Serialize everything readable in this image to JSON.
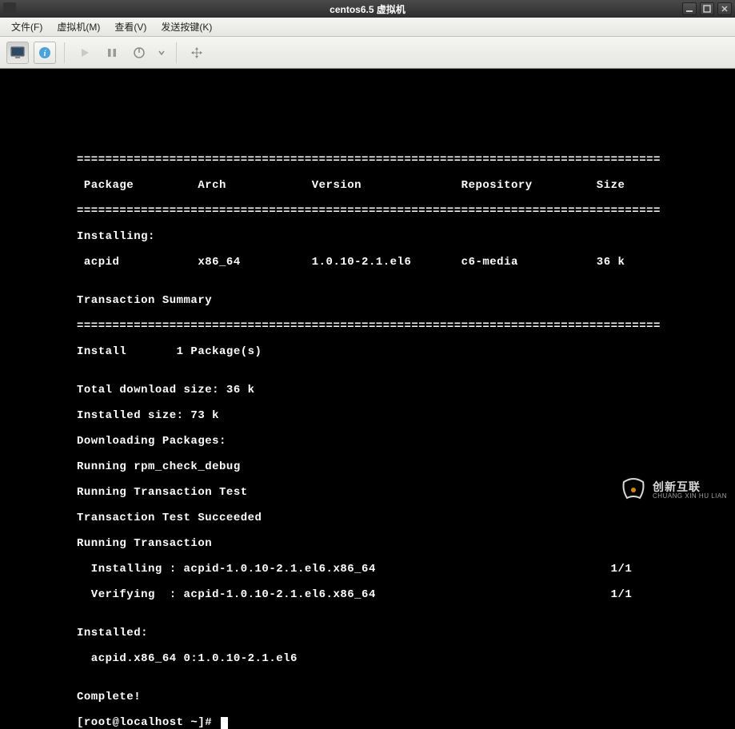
{
  "titlebar": {
    "title": "centos6.5 虚拟机"
  },
  "menu": {
    "file": "文件(F)",
    "vm": "虚拟机(M)",
    "view": "查看(V)",
    "send_keys": "发送按键(K)"
  },
  "terminal": {
    "divider": "==================================================================================",
    "header": " Package         Arch            Version              Repository         Size",
    "installing_section": "Installing:",
    "package_row": " acpid           x86_64          1.0.10-2.1.el6       c6-media           36 k",
    "summary_header": "Transaction Summary",
    "install_count": "Install       1 Package(s)",
    "download_size": "Total download size: 36 k",
    "installed_size": "Installed size: 73 k",
    "downloading": "Downloading Packages:",
    "rpm_check": "Running rpm_check_debug",
    "test_run": "Running Transaction Test",
    "test_pass": "Transaction Test Succeeded",
    "txn_run": "Running Transaction",
    "installing_line": "  Installing : acpid-1.0.10-2.1.el6.x86_64                                 1/1",
    "verifying_line": "  Verifying  : acpid-1.0.10-2.1.el6.x86_64                                 1/1",
    "installed_header": "Installed:",
    "installed_pkg": "  acpid.x86_64 0:1.0.10-2.1.el6",
    "complete": "Complete!",
    "prompt": "[root@localhost ~]# "
  },
  "watermark": {
    "name": "创新互联",
    "sub": "CHUANG XIN HU LIAN"
  }
}
